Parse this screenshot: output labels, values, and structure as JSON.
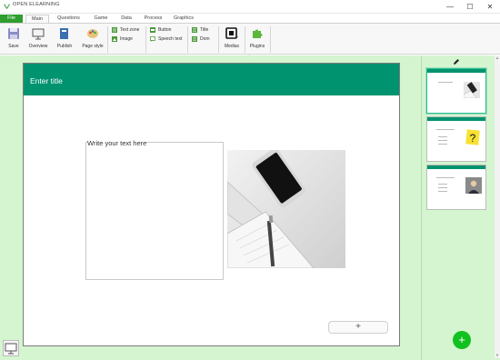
{
  "window": {
    "title": "OPEN ELEARNING",
    "minimize": "—",
    "maximize": "☐",
    "close": "✕"
  },
  "menu": {
    "tabs": [
      {
        "label": "File"
      },
      {
        "label": "Main"
      },
      {
        "label": "Questions"
      },
      {
        "label": "Game"
      },
      {
        "label": "Data"
      },
      {
        "label": "Process"
      },
      {
        "label": "Graphics"
      }
    ]
  },
  "ribbon": {
    "save": "Save",
    "overview": "Overview",
    "publish": "Publish",
    "page_style": "Page style",
    "text_zone": "Text zone",
    "image": "Image",
    "button": "Button",
    "speech_text": "Speech text",
    "title": "Title",
    "dom": "Dom",
    "medias": "Medias",
    "plugins": "Plugins",
    "collapse": "⌃"
  },
  "slide": {
    "title": "Enter title",
    "text_placeholder": "Write your text here",
    "add_button": "+"
  },
  "thumbnails": {
    "add_button": "+"
  },
  "colors": {
    "accent_green": "#009370",
    "workspace_bg": "#d4f5cf",
    "file_tab": "#2e9e2e",
    "fab": "#11c11f"
  },
  "icons": [
    "app-logo-icon",
    "save-icon",
    "overview-icon",
    "publish-icon",
    "palette-icon",
    "text-zone-icon",
    "image-icon",
    "button-icon",
    "speech-text-icon",
    "title-icon",
    "dom-icon",
    "medias-icon",
    "puzzle-icon",
    "pencil-icon",
    "presentation-icon"
  ]
}
